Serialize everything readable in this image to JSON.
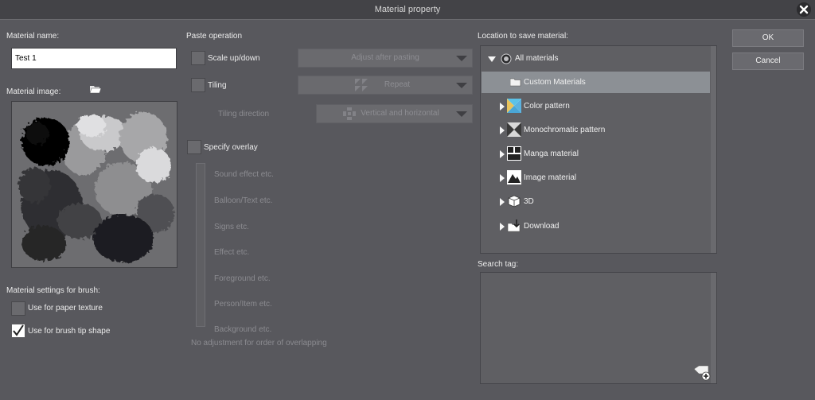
{
  "window": {
    "title": "Material property"
  },
  "left": {
    "name_label": "Material name:",
    "name_value": "Test 1",
    "image_label": "Material image:",
    "brush_settings_label": "Material settings for brush:",
    "paper_texture_label": "Use for paper texture",
    "brush_tip_label": "Use for brush tip shape"
  },
  "paste": {
    "heading": "Paste operation",
    "scale_label": "Scale up/down",
    "scale_combo": "Adjust after pasting",
    "tiling_label": "Tiling",
    "tiling_combo": "Repeat",
    "direction_label": "Tiling direction",
    "direction_combo": "Vertical and horizontal",
    "overlay_label": "Specify overlay",
    "layers": [
      "Sound effect etc.",
      "Balloon/Text etc.",
      "Signs etc.",
      "Effect etc.",
      "Foreground etc.",
      "Person/Item etc.",
      "Background etc."
    ],
    "no_adjust": "No adjustment for order of overlapping"
  },
  "location": {
    "heading": "Location to save material:",
    "items": [
      {
        "label": "All materials",
        "icon": "globe-icon"
      },
      {
        "label": "Custom Materials",
        "icon": "folder-icon"
      },
      {
        "label": "Color pattern",
        "icon": "color-pattern-icon"
      },
      {
        "label": "Monochromatic pattern",
        "icon": "mono-pattern-icon"
      },
      {
        "label": "Manga material",
        "icon": "manga-icon"
      },
      {
        "label": "Image material",
        "icon": "image-icon"
      },
      {
        "label": "3D",
        "icon": "cube-icon"
      },
      {
        "label": "Download",
        "icon": "download-icon"
      }
    ]
  },
  "search": {
    "heading": "Search tag:",
    "add_tag_icon": "add-tag-icon"
  },
  "buttons": {
    "ok": "OK",
    "cancel": "Cancel"
  }
}
